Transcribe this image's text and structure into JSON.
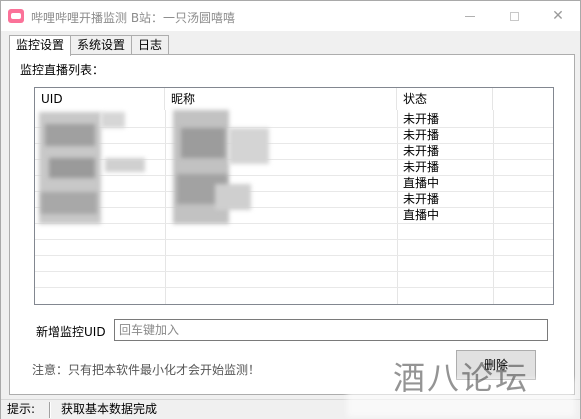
{
  "window": {
    "title": "哔哩哔哩开播监测   B站：一只汤圆嘻嘻",
    "buttons": {
      "minimize": "–",
      "maximize": "□",
      "close": "✕"
    }
  },
  "tabs": [
    {
      "label": "监控设置",
      "active": true
    },
    {
      "label": "系统设置",
      "active": false
    },
    {
      "label": "日志",
      "active": false
    }
  ],
  "monitor": {
    "list_label": "监控直播列表：",
    "columns": [
      "UID",
      "昵称",
      "状态"
    ],
    "rows": [
      {
        "status": "未开播"
      },
      {
        "status": "未开播"
      },
      {
        "status": "未开播"
      },
      {
        "status": "未开播"
      },
      {
        "status": "直播中"
      },
      {
        "status": "未开播"
      },
      {
        "status": "直播中"
      }
    ],
    "new_uid_label": "新增监控UID",
    "new_uid_placeholder": "回车键加入",
    "note": "注意：只有把本软件最小化才会开始监测！",
    "delete_button": "删除"
  },
  "watermark": "酒八论坛",
  "statusbar": {
    "label": "提示:",
    "message": "获取基本数据完成"
  },
  "colors": {
    "accent": "#fb7299",
    "border": "#adadad",
    "window_bg": "#f0f0f0"
  }
}
